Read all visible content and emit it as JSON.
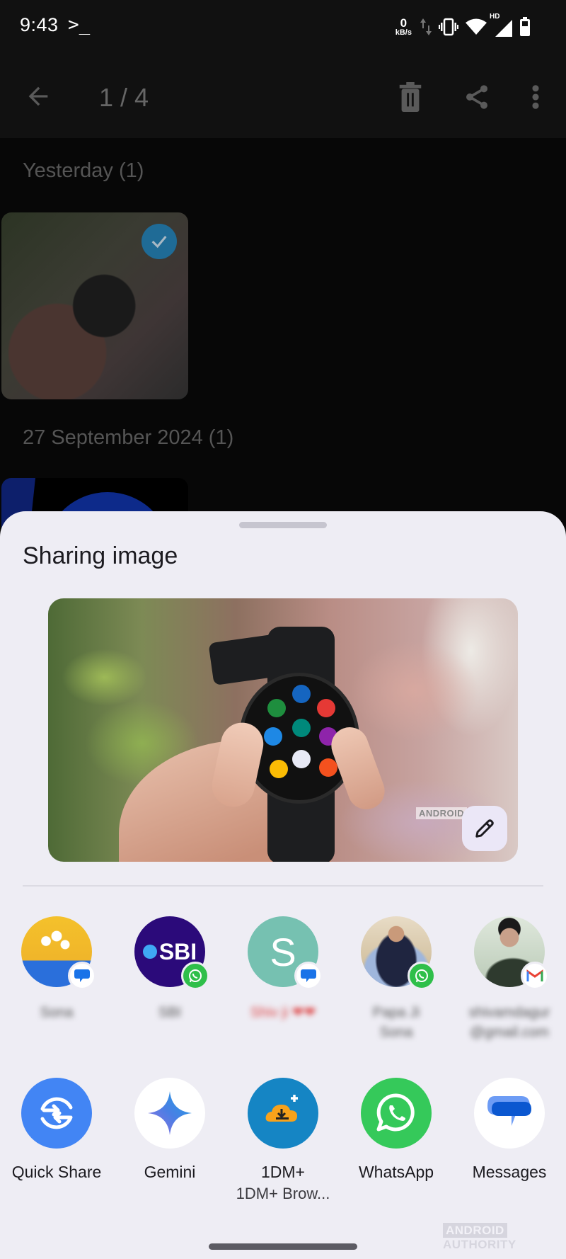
{
  "status_bar": {
    "time": "9:43",
    "terminal_glyph": ">_",
    "net_speed_value": "0",
    "net_speed_unit": "kB/s",
    "network_badge": "HD",
    "icons": [
      "data-activity-icon",
      "vibrate-icon",
      "wifi-icon",
      "cellular-signal-icon",
      "battery-icon"
    ]
  },
  "app_bar": {
    "counter": "1 / 4",
    "back_icon": "arrow-back-icon",
    "actions": [
      "delete-icon",
      "share-icon",
      "more-vert-icon"
    ]
  },
  "gallery": {
    "sections": [
      {
        "title": "Yesterday (1)",
        "selected": true
      },
      {
        "title": "27 September 2024 (1)",
        "selected": false
      }
    ]
  },
  "share_sheet": {
    "title": "Sharing image",
    "preview": {
      "watermark": "ANDROID",
      "edit_icon": "pencil-icon"
    },
    "contacts": [
      {
        "name": "Sona",
        "avatar": "flowers-vase",
        "via": "Messages",
        "via_color": "#1a73e8"
      },
      {
        "name": "SBI",
        "avatar": "SBI",
        "avatar_bg": "#2b0a7a",
        "via": "WhatsApp",
        "via_color": "#2fbf4a"
      },
      {
        "name": "Shiv ji ❤❤",
        "avatar": "S",
        "avatar_bg": "#76c1b1",
        "via": "Messages",
        "via_color": "#1a73e8"
      },
      {
        "name": "Papa Ji Sona",
        "avatar": "photo-man",
        "via": "WhatsApp",
        "via_color": "#2fbf4a"
      },
      {
        "name": "shivamdagur@gmail.com",
        "avatar": "photo-young-man",
        "via": "Gmail",
        "via_color": "#ea4335"
      }
    ],
    "apps": [
      {
        "label": "Quick Share",
        "sub": "",
        "bg": "#4285f4"
      },
      {
        "label": "Gemini",
        "sub": "",
        "bg": "#ffffff"
      },
      {
        "label": "1DM+",
        "sub": "1DM+ Brow...",
        "bg": "#1585c4"
      },
      {
        "label": "WhatsApp",
        "sub": "",
        "bg": "#35c95a"
      },
      {
        "label": "Messages",
        "sub": "",
        "bg": "#ffffff"
      }
    ],
    "watermark": {
      "boxed": "ANDROID",
      "text": "AUTHORITY"
    }
  }
}
